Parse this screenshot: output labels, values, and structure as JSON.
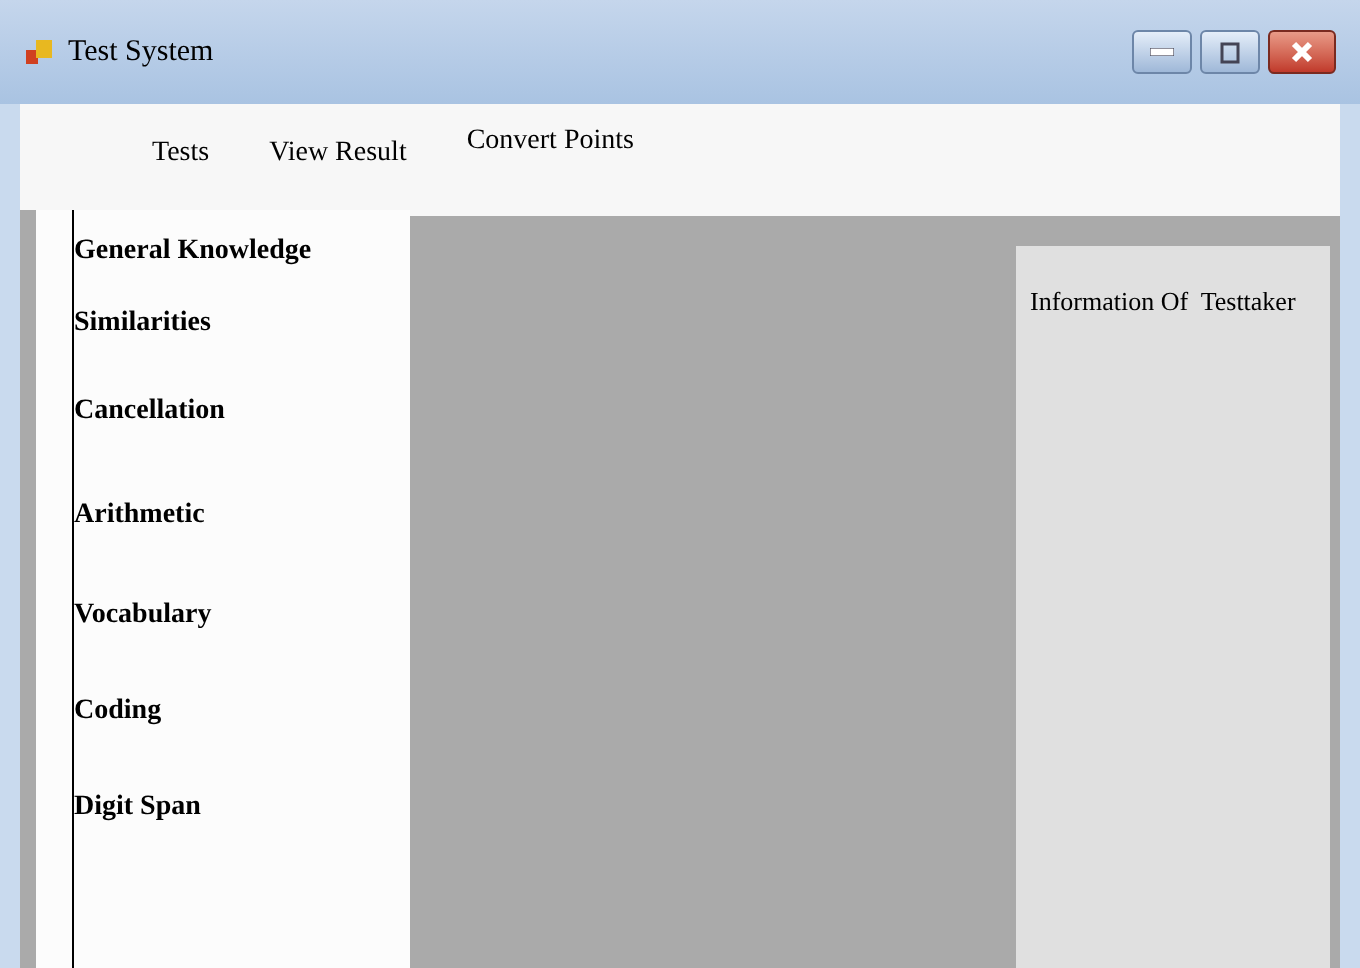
{
  "window": {
    "title": "Test System"
  },
  "menu": [
    {
      "label": "Tests"
    },
    {
      "label": "View Result"
    },
    {
      "label": "Convert Points"
    }
  ],
  "sidebar": {
    "items": [
      {
        "label": "General Knowledge"
      },
      {
        "label": "Similarities"
      },
      {
        "label": "Cancellation"
      },
      {
        "label": "Arithmetic"
      },
      {
        "label": "Vocabulary"
      },
      {
        "label": "Coding"
      },
      {
        "label": "Digit Span"
      }
    ]
  },
  "info_panel": {
    "title": "Information Of  Testtaker"
  }
}
